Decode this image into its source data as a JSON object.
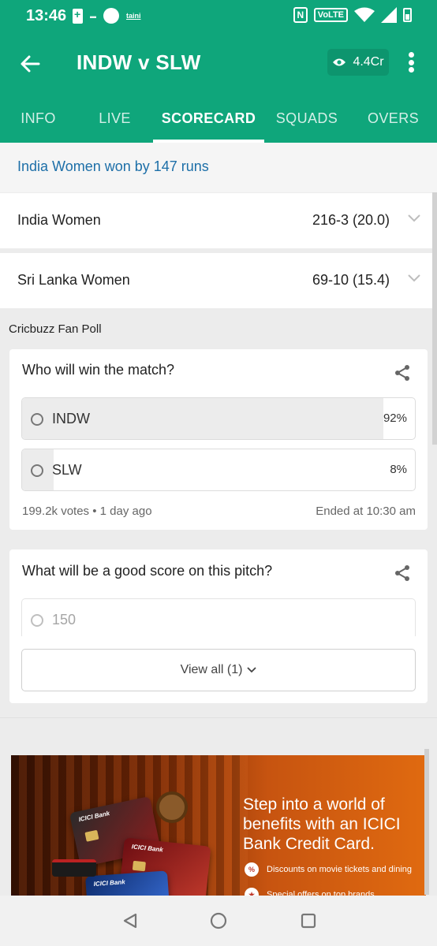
{
  "status_bar": {
    "time": "13:46",
    "notification_label": "taini",
    "network_badge": "VoLTE",
    "nfc_badge": "N",
    "icons": [
      "battery-charging-icon",
      "notification-dot-icon",
      "nfc-icon",
      "volte-icon",
      "wifi-icon",
      "signal-icon",
      "battery-icon"
    ]
  },
  "app_bar": {
    "title": "INDW v SLW",
    "views": "4.4Cr",
    "back_icon": "arrow-back-icon",
    "views_icon": "eye-icon",
    "menu_icon": "more-vert-icon"
  },
  "tabs": [
    {
      "label": "INFO",
      "active": false
    },
    {
      "label": "LIVE",
      "active": false
    },
    {
      "label": "SCORECARD",
      "active": true
    },
    {
      "label": "SQUADS",
      "active": false
    },
    {
      "label": "OVERS",
      "active": false
    }
  ],
  "result": "India Women won by 147 runs",
  "innings": [
    {
      "team": "India Women",
      "score": "216-3 (20.0)"
    },
    {
      "team": "Sri Lanka Women",
      "score": "69-10 (15.4)"
    }
  ],
  "fan_poll": {
    "heading": "Cricbuzz Fan Poll",
    "polls": [
      {
        "question": "Who will win the match?",
        "options": [
          {
            "label": "INDW",
            "percent_text": "92%",
            "fraction": 0.92
          },
          {
            "label": "SLW",
            "percent_text": "8%",
            "fraction": 0.08
          }
        ],
        "votes": "199.2k votes",
        "separator": "•",
        "time_ago": "1 day ago",
        "ended": "Ended at 10:30 am"
      },
      {
        "question": "What will be a good score on this pitch?",
        "options": [
          {
            "label": "150"
          }
        ],
        "view_all": "View all (1)"
      }
    ]
  },
  "ad": {
    "headline": "Step into a world of benefits with an ICICI Bank Credit Card.",
    "bullets": [
      "Discounts on movie tickets and dining",
      "Special offers on top brands"
    ],
    "card_brand": "ICICI Bank",
    "colors": {
      "primary": "#e06a10",
      "dark": "#3a1203"
    }
  },
  "colors": {
    "brand": "#0fa67b",
    "result_link": "#1d6fa8"
  },
  "nav_bar": {
    "icons": [
      "nav-back-icon",
      "nav-home-icon",
      "nav-recents-icon"
    ]
  }
}
